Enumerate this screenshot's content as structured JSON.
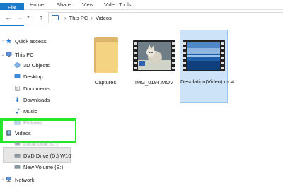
{
  "ribbon": {
    "tabs": [
      "File",
      "Home",
      "Share",
      "View",
      "Video Tools"
    ]
  },
  "address": {
    "segments": [
      "This PC",
      "Videos"
    ]
  },
  "nav": {
    "quick_access": "Quick access",
    "this_pc": "This PC",
    "objects_3d": "3D Objects",
    "desktop": "Desktop",
    "documents": "Documents",
    "downloads": "Downloads",
    "music": "Music",
    "pictures": "Pictures",
    "videos": "Videos",
    "local_disk": "Local Disk (C:)",
    "dvd_drive": "DVD Drive (D:) W10",
    "new_volume": "New Volume (E:)",
    "network": "Network"
  },
  "files": [
    {
      "name": "Captures",
      "type": "folder"
    },
    {
      "name": "IMG_0194.MOV",
      "type": "video"
    },
    {
      "name": "Desolation(Video).mp4",
      "type": "video",
      "selected": true
    }
  ],
  "colors": {
    "file_tab": "#1979ca",
    "highlight": "#26e62a",
    "selection": "#cde3f7"
  }
}
